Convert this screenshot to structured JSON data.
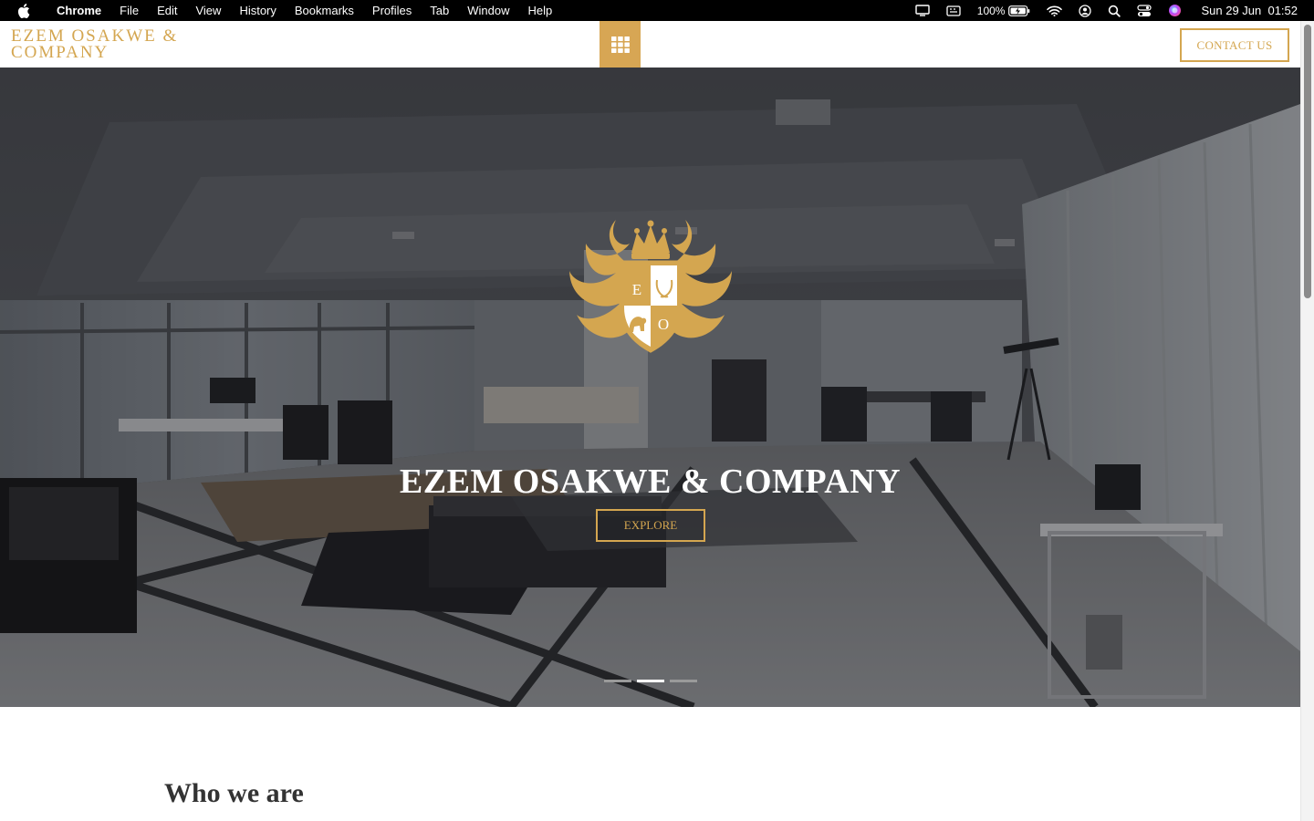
{
  "menubar": {
    "app_name": "Chrome",
    "menus": [
      "File",
      "Edit",
      "View",
      "History",
      "Bookmarks",
      "Profiles",
      "Tab",
      "Window",
      "Help"
    ],
    "battery": "100%",
    "datetime": "Sun 29 Jun  01:52"
  },
  "header": {
    "logo_line1": "EZEM OSAKWE &",
    "logo_line2": "COMPANY",
    "contact_label": "CONTACT US"
  },
  "hero": {
    "crest_letters": [
      "E",
      "O"
    ],
    "title": "EZEM OSAKWE & COMPANY",
    "explore_label": "EXPLORE",
    "slides_total": 3,
    "active_slide": 2
  },
  "section": {
    "title": "Who we are"
  },
  "colors": {
    "accent": "#d4a650",
    "menu_toggle_bg": "#d7a654",
    "menubar_bg": "#000000"
  }
}
